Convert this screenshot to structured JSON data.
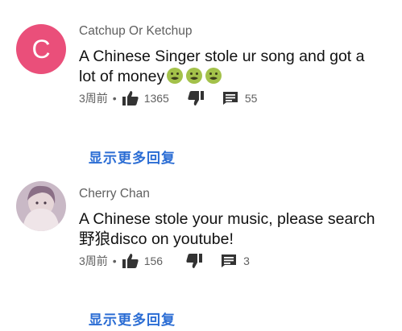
{
  "comments": [
    {
      "avatar_letter": "C",
      "author": "Catchup Or Ketchup",
      "text_line1": "A Chinese Singer stole ur song and got a",
      "text_line2": "lot of money",
      "emoji": [
        "nauseated-face",
        "nauseated-face",
        "nauseated-face"
      ],
      "time": "3周前",
      "separator": "•",
      "likes": "1365",
      "replies_count": "55",
      "show_more": "显示更多回复"
    },
    {
      "author": "Cherry Chan",
      "text_line1": "A Chinese stole your music, please search",
      "text_line2": "野狼disco on youtube!",
      "time": "3周前",
      "separator": "•",
      "likes": "156",
      "replies_count": "3",
      "show_more": "显示更多回复"
    }
  ],
  "colors": {
    "accent": "#2b6dd4",
    "avatar_bg": "#ea4f7a",
    "meta": "#606060"
  }
}
